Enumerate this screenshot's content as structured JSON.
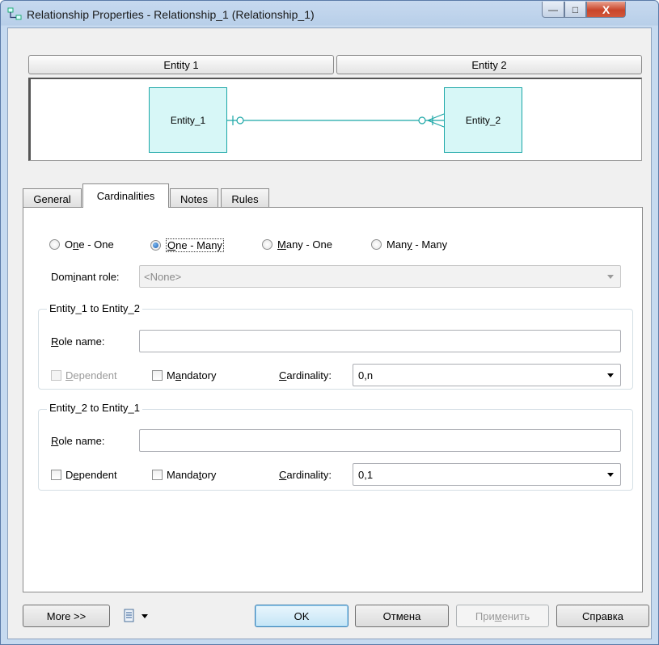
{
  "window": {
    "title": "Relationship Properties - Relationship_1 (Relationship_1)",
    "minimize_glyph": "—",
    "maximize_glyph": "□",
    "close_glyph": "X"
  },
  "diagram": {
    "entity1_header": "Entity 1",
    "entity2_header": "Entity 2",
    "entity1_name": "Entity_1",
    "entity2_name": "Entity_2",
    "line_color": "#1aa6a6"
  },
  "tabs": [
    {
      "label": "General"
    },
    {
      "label": "Cardinalities",
      "active": true
    },
    {
      "label": "Notes"
    },
    {
      "label": "Rules"
    }
  ],
  "cardinality_type": {
    "options": [
      {
        "pre": "O",
        "key": "n",
        "post": "e - One",
        "selected": false
      },
      {
        "pre": "",
        "key": "O",
        "post": "ne - Many",
        "selected": true
      },
      {
        "pre": "",
        "key": "M",
        "post": "any - One",
        "selected": false
      },
      {
        "pre": "Man",
        "key": "y",
        "post": " - Many",
        "selected": false
      }
    ]
  },
  "dominant_role": {
    "label_pre": "Dom",
    "label_key": "i",
    "label_post": "nant role:",
    "value": "<None>"
  },
  "group1": {
    "title": "Entity_1 to Entity_2",
    "role_label_key": "R",
    "role_label_post": "ole name:",
    "role_value": "",
    "dependent_key": "D",
    "dependent_post": "ependent",
    "dependent_checked": false,
    "dependent_enabled": false,
    "mandatory_pre": "M",
    "mandatory_key": "a",
    "mandatory_post": "ndatory",
    "mandatory_checked": false,
    "cardinality_key": "C",
    "cardinality_post": "ardinality:",
    "cardinality_value": "0,n"
  },
  "group2": {
    "title": "Entity_2 to Entity_1",
    "role_label_key": "R",
    "role_label_post": "ole name:",
    "role_value": "",
    "dependent_pre": "D",
    "dependent_key": "e",
    "dependent_post": "pendent",
    "dependent_checked": false,
    "mandatory_pre": "Manda",
    "mandatory_key": "t",
    "mandatory_post": "ory",
    "mandatory_checked": false,
    "cardinality_key": "C",
    "cardinality_post": "ardinality:",
    "cardinality_value": "0,1"
  },
  "footer": {
    "more_label": "More >>",
    "ok_label": "OK",
    "cancel_label": "Отмена",
    "apply_pre": "При",
    "apply_key": "м",
    "apply_post": "енить",
    "help_label": "Справка"
  }
}
